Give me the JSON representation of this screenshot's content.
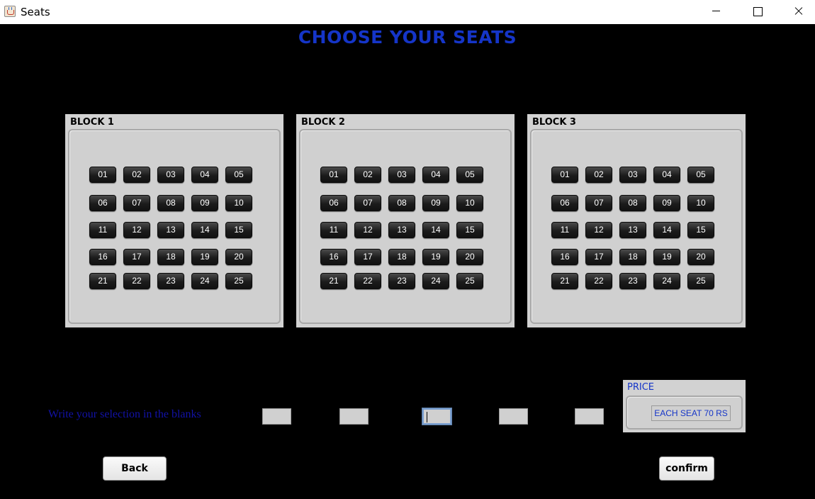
{
  "window": {
    "title": "Seats",
    "controls": [
      "minimize",
      "maximize",
      "close"
    ]
  },
  "heading": "CHOOSE YOUR SEATS",
  "blocks": [
    {
      "title": "BLOCK 1",
      "seats": [
        "01",
        "02",
        "03",
        "04",
        "05",
        "06",
        "07",
        "08",
        "09",
        "10",
        "11",
        "12",
        "13",
        "14",
        "15",
        "16",
        "17",
        "18",
        "19",
        "20",
        "21",
        "22",
        "23",
        "24",
        "25"
      ]
    },
    {
      "title": "BLOCK 2",
      "seats": [
        "01",
        "02",
        "03",
        "04",
        "05",
        "06",
        "07",
        "08",
        "09",
        "10",
        "11",
        "12",
        "13",
        "14",
        "15",
        "16",
        "17",
        "18",
        "19",
        "20",
        "21",
        "22",
        "23",
        "24",
        "25"
      ]
    },
    {
      "title": "BLOCK 3",
      "seats": [
        "01",
        "02",
        "03",
        "04",
        "05",
        "06",
        "07",
        "08",
        "09",
        "10",
        "11",
        "12",
        "13",
        "14",
        "15",
        "16",
        "17",
        "18",
        "19",
        "20",
        "21",
        "22",
        "23",
        "24",
        "25"
      ]
    }
  ],
  "selection": {
    "instruction": "Write your selection in the blanks",
    "blanks": [
      "",
      "",
      "",
      "",
      ""
    ],
    "focused_index": 2
  },
  "price": {
    "title": "PRICE",
    "value": "EACH SEAT 70 RS"
  },
  "buttons": {
    "back": "Back",
    "confirm": "confirm"
  },
  "colors": {
    "background": "#000000",
    "heading": "#1535c8",
    "panel": "#d2d2d2",
    "seat": "#1b1b1b",
    "instruction": "#1212a8"
  },
  "icons": {
    "app": "java-cup-icon",
    "minimize": "minimize-icon",
    "maximize": "maximize-icon",
    "close": "close-icon"
  }
}
